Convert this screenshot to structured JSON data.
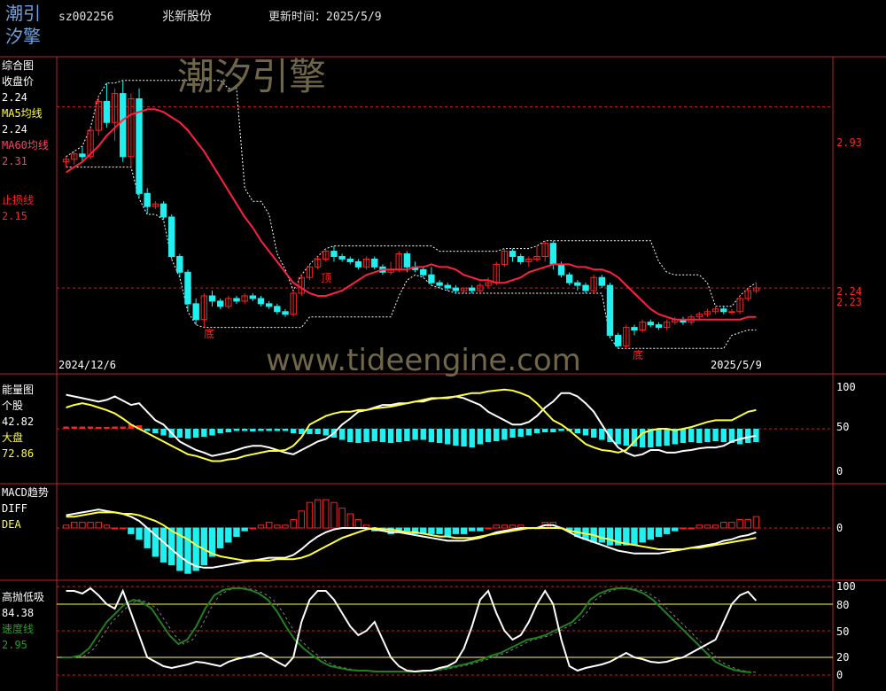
{
  "header": {
    "logo_line1": "潮引",
    "logo_line2": "汐擎",
    "code": "sz002256",
    "name": "兆新股份",
    "update_label": "更新时间：2025/5/9"
  },
  "watermarks": {
    "brand": "潮汐引擎",
    "url": "www.tideengine.com"
  },
  "colors": {
    "bg": "#000000",
    "frame": "#c0202a",
    "up": "#ff2020",
    "down": "#20f0f0",
    "ma60": "#ff2040",
    "yellow": "#ffff40",
    "white": "#ffffff",
    "green": "#208020"
  },
  "panels": {
    "main": {
      "title": "综合图",
      "labels": [
        {
          "text": "收盘价",
          "color": "#ffffff"
        },
        {
          "text": "2.24",
          "color": "#ffffff"
        },
        {
          "text": "MA5均线",
          "color": "#ffff40"
        },
        {
          "text": "2.24",
          "color": "#ffffff"
        },
        {
          "text": "MA60均线",
          "color": "#ff4060"
        },
        {
          "text": "2.31",
          "color": "#ff4060"
        },
        {
          "text": "止损线",
          "color": "#ff2020"
        },
        {
          "text": "2.15",
          "color": "#ff2020"
        }
      ],
      "right_ticks": [
        "2.93",
        "2.24",
        "2.23"
      ],
      "date_start": "2024/12/6",
      "date_end": "2025/5/9",
      "marks": [
        "顶",
        "底",
        "底"
      ]
    },
    "energy": {
      "title": "能量图",
      "labels": [
        {
          "text": "个股",
          "color": "#ffffff"
        },
        {
          "text": "42.82",
          "color": "#ffffff"
        },
        {
          "text": "大盘",
          "color": "#ffff40"
        },
        {
          "text": "72.86",
          "color": "#ffff40"
        }
      ],
      "right_ticks": [
        "100",
        "50",
        "0"
      ]
    },
    "macd": {
      "title": "MACD趋势",
      "labels": [
        {
          "text": "DIFF",
          "color": "#ffffff"
        },
        {
          "text": "DEA",
          "color": "#ffff40"
        }
      ],
      "right_ticks": [
        "0"
      ]
    },
    "osc": {
      "title": "高抛低吸",
      "labels": [
        {
          "text": "84.38",
          "color": "#ffffff"
        },
        {
          "text": "速度线",
          "color": "#20a020"
        },
        {
          "text": "2.95",
          "color": "#20a020"
        }
      ],
      "right_ticks": [
        "100",
        "80",
        "50",
        "20",
        "0"
      ]
    }
  },
  "chart_data": {
    "type": "candlestick+indicators",
    "candles": [
      [
        2.72,
        2.74,
        2.7,
        2.73
      ],
      [
        2.73,
        2.76,
        2.71,
        2.75
      ],
      [
        2.75,
        2.78,
        2.72,
        2.74
      ],
      [
        2.74,
        2.85,
        2.73,
        2.84
      ],
      [
        2.84,
        2.97,
        2.82,
        2.95
      ],
      [
        2.95,
        3.02,
        2.85,
        2.87
      ],
      [
        2.87,
        3.0,
        2.8,
        2.98
      ],
      [
        2.98,
        3.03,
        2.72,
        2.74
      ],
      [
        2.74,
        2.98,
        2.7,
        2.96
      ],
      [
        2.96,
        3.0,
        2.58,
        2.6
      ],
      [
        2.6,
        2.62,
        2.52,
        2.55
      ],
      [
        2.55,
        2.57,
        2.54,
        2.56
      ],
      [
        2.56,
        2.57,
        2.5,
        2.51
      ],
      [
        2.51,
        2.52,
        2.35,
        2.36
      ],
      [
        2.36,
        2.37,
        2.28,
        2.3
      ],
      [
        2.3,
        2.31,
        2.15,
        2.18
      ],
      [
        2.18,
        2.2,
        2.1,
        2.12
      ],
      [
        2.12,
        2.22,
        2.09,
        2.21
      ],
      [
        2.21,
        2.23,
        2.17,
        2.19
      ],
      [
        2.19,
        2.2,
        2.16,
        2.17
      ],
      [
        2.17,
        2.21,
        2.16,
        2.2
      ],
      [
        2.2,
        2.21,
        2.18,
        2.19
      ],
      [
        2.19,
        2.22,
        2.18,
        2.21
      ],
      [
        2.21,
        2.22,
        2.19,
        2.2
      ],
      [
        2.2,
        2.21,
        2.17,
        2.18
      ],
      [
        2.18,
        2.19,
        2.16,
        2.17
      ],
      [
        2.17,
        2.18,
        2.14,
        2.15
      ],
      [
        2.15,
        2.16,
        2.13,
        2.14
      ],
      [
        2.14,
        2.23,
        2.13,
        2.22
      ],
      [
        2.22,
        2.29,
        2.21,
        2.28
      ],
      [
        2.28,
        2.33,
        2.27,
        2.32
      ],
      [
        2.32,
        2.36,
        2.31,
        2.35
      ],
      [
        2.35,
        2.39,
        2.34,
        2.38
      ],
      [
        2.38,
        2.4,
        2.34,
        2.36
      ],
      [
        2.36,
        2.37,
        2.34,
        2.35
      ],
      [
        2.35,
        2.36,
        2.33,
        2.34
      ],
      [
        2.34,
        2.35,
        2.31,
        2.32
      ],
      [
        2.32,
        2.36,
        2.31,
        2.35
      ],
      [
        2.35,
        2.36,
        2.31,
        2.32
      ],
      [
        2.32,
        2.33,
        2.29,
        2.3
      ],
      [
        2.3,
        2.34,
        2.29,
        2.31
      ],
      [
        2.31,
        2.38,
        2.3,
        2.37
      ],
      [
        2.37,
        2.38,
        2.3,
        2.32
      ],
      [
        2.32,
        2.34,
        2.3,
        2.31
      ],
      [
        2.31,
        2.32,
        2.28,
        2.29
      ],
      [
        2.29,
        2.32,
        2.25,
        2.26
      ],
      [
        2.26,
        2.27,
        2.24,
        2.25
      ],
      [
        2.25,
        2.26,
        2.23,
        2.24
      ],
      [
        2.24,
        2.25,
        2.22,
        2.23
      ],
      [
        2.23,
        2.24,
        2.22,
        2.24
      ],
      [
        2.24,
        2.25,
        2.22,
        2.23
      ],
      [
        2.23,
        2.26,
        2.22,
        2.25
      ],
      [
        2.25,
        2.28,
        2.24,
        2.26
      ],
      [
        2.26,
        2.34,
        2.25,
        2.33
      ],
      [
        2.33,
        2.39,
        2.32,
        2.38
      ],
      [
        2.38,
        2.39,
        2.34,
        2.36
      ],
      [
        2.36,
        2.37,
        2.33,
        2.34
      ],
      [
        2.34,
        2.36,
        2.32,
        2.35
      ],
      [
        2.35,
        2.4,
        2.34,
        2.36
      ],
      [
        2.36,
        2.42,
        2.34,
        2.41
      ],
      [
        2.41,
        2.42,
        2.31,
        2.33
      ],
      [
        2.33,
        2.34,
        2.28,
        2.29
      ],
      [
        2.29,
        2.3,
        2.25,
        2.26
      ],
      [
        2.26,
        2.27,
        2.23,
        2.25
      ],
      [
        2.25,
        2.26,
        2.22,
        2.23
      ],
      [
        2.23,
        2.29,
        2.22,
        2.28
      ],
      [
        2.28,
        2.29,
        2.24,
        2.25
      ],
      [
        2.25,
        2.26,
        2.05,
        2.06
      ],
      [
        2.06,
        2.07,
        2.01,
        2.02
      ],
      [
        2.02,
        2.1,
        2.01,
        2.09
      ],
      [
        2.09,
        2.1,
        2.06,
        2.08
      ],
      [
        2.08,
        2.12,
        2.07,
        2.11
      ],
      [
        2.11,
        2.12,
        2.09,
        2.1
      ],
      [
        2.1,
        2.11,
        2.08,
        2.09
      ],
      [
        2.09,
        2.12,
        2.08,
        2.11
      ],
      [
        2.11,
        2.13,
        2.1,
        2.12
      ],
      [
        2.12,
        2.13,
        2.1,
        2.11
      ],
      [
        2.11,
        2.14,
        2.1,
        2.13
      ],
      [
        2.13,
        2.15,
        2.12,
        2.14
      ],
      [
        2.14,
        2.16,
        2.13,
        2.15
      ],
      [
        2.15,
        2.17,
        2.14,
        2.16
      ],
      [
        2.16,
        2.17,
        2.14,
        2.15
      ],
      [
        2.15,
        2.16,
        2.14,
        2.15
      ],
      [
        2.15,
        2.21,
        2.14,
        2.2
      ],
      [
        2.2,
        2.24,
        2.19,
        2.23
      ],
      [
        2.23,
        2.26,
        2.22,
        2.24
      ]
    ],
    "ma60": [
      2.68,
      2.7,
      2.72,
      2.75,
      2.78,
      2.82,
      2.85,
      2.88,
      2.9,
      2.91,
      2.92,
      2.92,
      2.91,
      2.89,
      2.87,
      2.84,
      2.8,
      2.76,
      2.71,
      2.66,
      2.61,
      2.56,
      2.51,
      2.47,
      2.42,
      2.38,
      2.34,
      2.3,
      2.26,
      2.24,
      2.22,
      2.21,
      2.21,
      2.22,
      2.23,
      2.25,
      2.27,
      2.29,
      2.3,
      2.31,
      2.31,
      2.31,
      2.31,
      2.32,
      2.32,
      2.33,
      2.32,
      2.32,
      2.31,
      2.29,
      2.28,
      2.27,
      2.27,
      2.26,
      2.26,
      2.27,
      2.28,
      2.3,
      2.31,
      2.32,
      2.33,
      2.33,
      2.33,
      2.32,
      2.32,
      2.31,
      2.31,
      2.3,
      2.28,
      2.25,
      2.22,
      2.19,
      2.16,
      2.14,
      2.13,
      2.12,
      2.12,
      2.12,
      2.12,
      2.12,
      2.12,
      2.12,
      2.12,
      2.12,
      2.13,
      2.13
    ],
    "energy": {
      "stock": [
        90,
        88,
        86,
        84,
        82,
        84,
        88,
        83,
        78,
        80,
        70,
        60,
        55,
        45,
        35,
        30,
        25,
        22,
        18,
        20,
        22,
        25,
        28,
        30,
        30,
        28,
        25,
        22,
        20,
        25,
        30,
        35,
        38,
        45,
        55,
        62,
        70,
        72,
        75,
        78,
        78,
        80,
        80,
        82,
        82,
        85,
        86,
        86,
        88,
        86,
        82,
        78,
        70,
        65,
        60,
        55,
        55,
        58,
        65,
        75,
        82,
        92,
        92,
        88,
        80,
        70,
        55,
        40,
        28,
        22,
        18,
        20,
        25,
        25,
        22,
        22,
        24,
        25,
        27,
        28,
        28,
        30,
        35,
        38,
        40,
        42
      ],
      "market": [
        75,
        78,
        80,
        78,
        75,
        72,
        68,
        62,
        55,
        50,
        45,
        40,
        35,
        30,
        25,
        20,
        18,
        15,
        12,
        12,
        14,
        15,
        18,
        20,
        22,
        24,
        24,
        25,
        30,
        40,
        55,
        60,
        65,
        68,
        70,
        70,
        72,
        72,
        74,
        75,
        76,
        78,
        80,
        82,
        84,
        86,
        86,
        87,
        88,
        90,
        92,
        92,
        94,
        95,
        96,
        95,
        92,
        88,
        80,
        70,
        60,
        55,
        48,
        40,
        32,
        28,
        25,
        24,
        22,
        25,
        35,
        45,
        48,
        50,
        50,
        48,
        50,
        52,
        55,
        58,
        60,
        60,
        60,
        65,
        70,
        72
      ],
      "bars": [
        5,
        5,
        5,
        5,
        4,
        4,
        5,
        5,
        10,
        8,
        -5,
        -10,
        -15,
        -20,
        -20,
        -22,
        -20,
        -18,
        -15,
        -10,
        -8,
        -5,
        -5,
        -6,
        -5,
        -5,
        -5,
        -5,
        -10,
        -12,
        -12,
        -12,
        -15,
        -20,
        -25,
        -30,
        -32,
        -30,
        -28,
        -30,
        -32,
        -30,
        -28,
        -25,
        -25,
        -30,
        -32,
        -35,
        -38,
        -40,
        -42,
        -35,
        -30,
        -28,
        -25,
        -20,
        -18,
        -15,
        -10,
        -8,
        -8,
        -5,
        -5,
        -10,
        -15,
        -20,
        -25,
        -30,
        -35,
        -38,
        -40,
        -42,
        -42,
        -40,
        -38,
        -35,
        -32,
        -30,
        -32,
        -30,
        -28,
        -30,
        -32,
        -35,
        -32,
        -30
      ]
    },
    "macd": {
      "diff": [
        0.09,
        0.1,
        0.11,
        0.12,
        0.13,
        0.12,
        0.11,
        0.1,
        0.08,
        0.05,
        0.0,
        -0.05,
        -0.1,
        -0.15,
        -0.2,
        -0.24,
        -0.27,
        -0.28,
        -0.28,
        -0.27,
        -0.26,
        -0.25,
        -0.24,
        -0.23,
        -0.22,
        -0.21,
        -0.21,
        -0.21,
        -0.19,
        -0.15,
        -0.1,
        -0.06,
        -0.03,
        -0.01,
        0.0,
        0.0,
        0.0,
        0.0,
        -0.01,
        -0.02,
        -0.03,
        -0.03,
        -0.04,
        -0.05,
        -0.06,
        -0.07,
        -0.08,
        -0.09,
        -0.09,
        -0.09,
        -0.08,
        -0.07,
        -0.05,
        -0.03,
        -0.02,
        -0.01,
        0.0,
        0.0,
        0.0,
        0.02,
        0.02,
        0.0,
        -0.03,
        -0.06,
        -0.08,
        -0.1,
        -0.12,
        -0.14,
        -0.16,
        -0.17,
        -0.18,
        -0.18,
        -0.18,
        -0.18,
        -0.17,
        -0.16,
        -0.15,
        -0.14,
        -0.13,
        -0.12,
        -0.11,
        -0.09,
        -0.08,
        -0.06,
        -0.05,
        -0.03
      ],
      "dea": [
        0.08,
        0.08,
        0.09,
        0.1,
        0.11,
        0.11,
        0.11,
        0.1,
        0.1,
        0.09,
        0.07,
        0.05,
        0.02,
        -0.02,
        -0.05,
        -0.08,
        -0.12,
        -0.15,
        -0.18,
        -0.2,
        -0.21,
        -0.22,
        -0.23,
        -0.23,
        -0.23,
        -0.23,
        -0.22,
        -0.22,
        -0.22,
        -0.21,
        -0.19,
        -0.16,
        -0.13,
        -0.1,
        -0.07,
        -0.05,
        -0.03,
        -0.01,
        0.0,
        -0.01,
        -0.01,
        -0.02,
        -0.03,
        -0.03,
        -0.04,
        -0.05,
        -0.06,
        -0.06,
        -0.07,
        -0.07,
        -0.07,
        -0.06,
        -0.05,
        -0.04,
        -0.03,
        -0.02,
        -0.01,
        0.0,
        0.0,
        0.0,
        0.0,
        0.0,
        -0.02,
        -0.03,
        -0.04,
        -0.05,
        -0.07,
        -0.08,
        -0.1,
        -0.11,
        -0.12,
        -0.13,
        -0.14,
        -0.15,
        -0.15,
        -0.15,
        -0.15,
        -0.14,
        -0.14,
        -0.13,
        -0.12,
        -0.11,
        -0.1,
        -0.09,
        -0.08,
        -0.07
      ],
      "hist": [
        0.02,
        0.04,
        0.04,
        0.04,
        0.04,
        0.02,
        0.0,
        0.0,
        -0.04,
        -0.08,
        -0.14,
        -0.2,
        -0.24,
        -0.26,
        -0.3,
        -0.32,
        -0.3,
        -0.26,
        -0.2,
        -0.14,
        -0.1,
        -0.06,
        -0.02,
        0.0,
        0.02,
        0.04,
        0.02,
        0.02,
        0.06,
        0.12,
        0.18,
        0.2,
        0.2,
        0.18,
        0.14,
        0.1,
        0.06,
        0.02,
        -0.02,
        -0.02,
        -0.04,
        -0.02,
        -0.02,
        -0.04,
        -0.04,
        -0.04,
        -0.04,
        -0.06,
        -0.04,
        -0.04,
        -0.02,
        -0.02,
        0.0,
        0.02,
        0.02,
        0.02,
        0.02,
        0.0,
        0.0,
        0.04,
        0.04,
        0.0,
        -0.02,
        -0.06,
        -0.08,
        -0.1,
        -0.1,
        -0.12,
        -0.12,
        -0.12,
        -0.12,
        -0.1,
        -0.08,
        -0.06,
        -0.04,
        -0.02,
        0.0,
        0.0,
        0.02,
        0.02,
        0.02,
        0.04,
        0.04,
        0.06,
        0.06,
        0.08
      ]
    },
    "osc": {
      "white": [
        95,
        95,
        92,
        98,
        90,
        80,
        75,
        95,
        70,
        45,
        20,
        15,
        10,
        8,
        10,
        12,
        15,
        14,
        12,
        10,
        15,
        18,
        20,
        22,
        25,
        20,
        15,
        10,
        20,
        60,
        85,
        95,
        95,
        85,
        70,
        55,
        45,
        50,
        60,
        40,
        20,
        10,
        5,
        4,
        5,
        5,
        8,
        10,
        15,
        30,
        55,
        85,
        95,
        70,
        50,
        40,
        45,
        60,
        80,
        95,
        80,
        40,
        10,
        5,
        8,
        10,
        12,
        15,
        20,
        25,
        20,
        18,
        15,
        14,
        15,
        18,
        20,
        25,
        30,
        35,
        40,
        60,
        80,
        90,
        94,
        84
      ],
      "speed": [
        20,
        20,
        22,
        30,
        45,
        60,
        70,
        80,
        85,
        82,
        75,
        60,
        45,
        35,
        40,
        55,
        75,
        90,
        96,
        98,
        98,
        96,
        92,
        85,
        72,
        55,
        40,
        30,
        22,
        15,
        10,
        8,
        6,
        5,
        5,
        4,
        4,
        4,
        4,
        4,
        4,
        5,
        6,
        8,
        10,
        12,
        15,
        18,
        22,
        25,
        30,
        35,
        40,
        42,
        45,
        50,
        55,
        60,
        70,
        85,
        92,
        96,
        98,
        98,
        96,
        92,
        85,
        75,
        65,
        55,
        45,
        35,
        25,
        15,
        10,
        6,
        4,
        3
      ]
    }
  }
}
